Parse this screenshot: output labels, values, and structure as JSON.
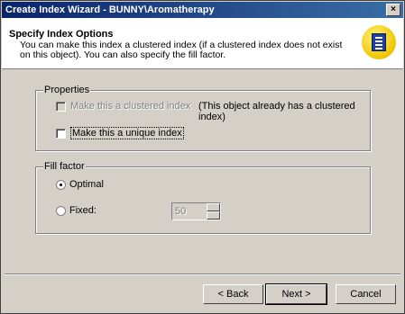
{
  "window": {
    "title": "Create Index Wizard - BUNNY\\Aromatherapy",
    "close_glyph": "×"
  },
  "header": {
    "title": "Specify Index Options",
    "description": "You can make this index a clustered index (if a clustered index does not exist on this object). You can also specify the fill factor.",
    "icon": "wizard-index-icon"
  },
  "properties": {
    "legend": "Properties",
    "clustered_label": "Make this a clustered index",
    "clustered_note": "(This object already has a clustered index)",
    "clustered_checked": false,
    "clustered_enabled": false,
    "unique_label": "Make this a unique index",
    "unique_checked": false
  },
  "fill_factor": {
    "legend": "Fill factor",
    "optimal_label": "Optimal",
    "fixed_label": "Fixed:",
    "selected": "Optimal",
    "fixed_value": "50"
  },
  "buttons": {
    "back": "< Back",
    "next": "Next >",
    "cancel": "Cancel"
  }
}
